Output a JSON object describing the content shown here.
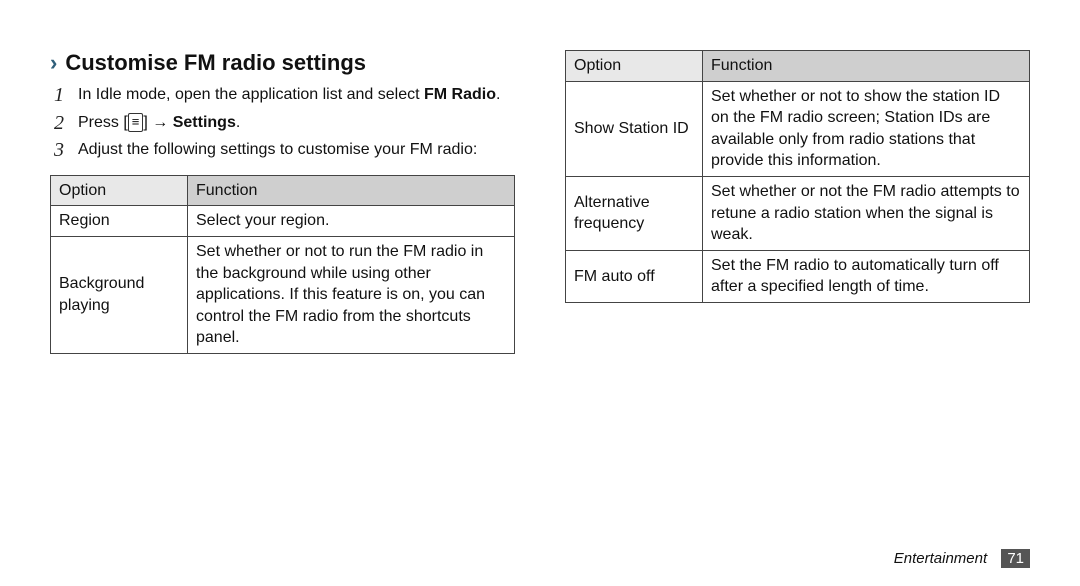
{
  "heading": "Customise FM radio settings",
  "steps": {
    "s1": {
      "pre": "In Idle mode, open the application list and select ",
      "bold": "FM Radio",
      "post": "."
    },
    "s2": {
      "pre": "Press [",
      "key_glyph": "≡",
      "mid": "] → ",
      "bold": "Settings",
      "post": "."
    },
    "s3": "Adjust the following settings to customise your FM radio:"
  },
  "table_headers": {
    "option": "Option",
    "function": "Function"
  },
  "table_left": [
    {
      "option": "Region",
      "function": "Select your region."
    },
    {
      "option": "Background playing",
      "function": "Set whether or not to run the FM radio in the background while using other applications. If this feature is on, you can control the FM radio from the shortcuts panel."
    }
  ],
  "table_right": [
    {
      "option": "Show Station ID",
      "function": "Set whether or not to show the station ID on the FM radio screen; Station IDs are available only from radio stations that provide this information."
    },
    {
      "option": "Alternative frequency",
      "function": "Set whether or not the FM radio attempts to retune a radio station when the signal is weak."
    },
    {
      "option": "FM auto off",
      "function": "Set the FM radio to automatically turn off after a specified length of time."
    }
  ],
  "footer": {
    "section": "Entertainment",
    "page": "71"
  }
}
